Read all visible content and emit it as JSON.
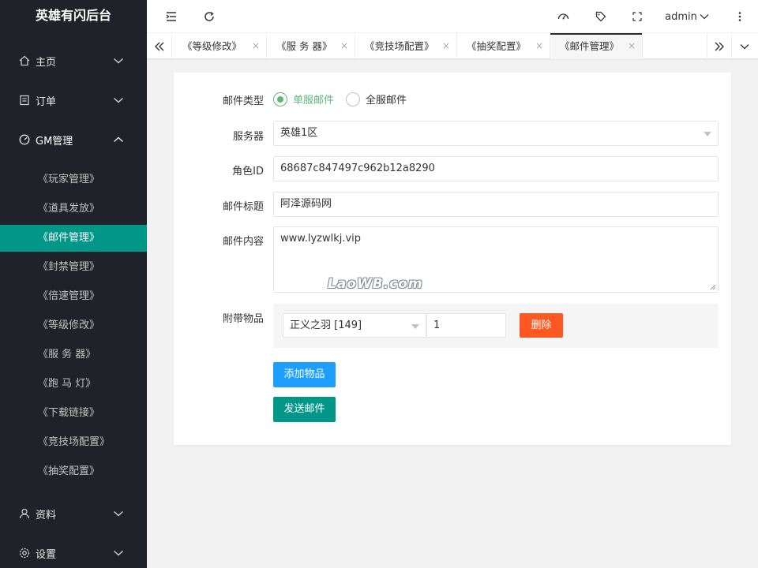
{
  "app": {
    "title": "英雄有闪后台"
  },
  "sidebar": {
    "groups": [
      {
        "label": "主页",
        "icon": "home-icon",
        "expanded": false
      },
      {
        "label": "订单",
        "icon": "list-icon",
        "expanded": false
      },
      {
        "label": "GM管理",
        "icon": "dashboard-icon",
        "expanded": true
      },
      {
        "label": "资料",
        "icon": "user-icon",
        "expanded": false
      },
      {
        "label": "设置",
        "icon": "settings-icon",
        "expanded": false
      }
    ],
    "gm_items": [
      {
        "label": "《玩家管理》"
      },
      {
        "label": "《道具发放》"
      },
      {
        "label": "《邮件管理》",
        "active": true
      },
      {
        "label": "《封禁管理》"
      },
      {
        "label": "《倍速管理》"
      },
      {
        "label": "《等级修改》"
      },
      {
        "label": "《服 务 器》"
      },
      {
        "label": "《跑 马 灯》"
      },
      {
        "label": "《下载链接》"
      },
      {
        "label": "《竞技场配置》"
      },
      {
        "label": "《抽奖配置》"
      }
    ]
  },
  "header": {
    "user": "admin",
    "icons": [
      "menu-fold-icon",
      "refresh-icon",
      "theme-icon",
      "note-icon",
      "fullscreen-icon",
      "more-icon"
    ]
  },
  "tabs": {
    "items": [
      {
        "label": "《等级修改》"
      },
      {
        "label": "《服 务 器》"
      },
      {
        "label": "《竞技场配置》"
      },
      {
        "label": "《抽奖配置》"
      },
      {
        "label": "《邮件管理》",
        "active": true
      }
    ],
    "close_glyph": "×"
  },
  "form": {
    "mail_type": {
      "label": "邮件类型",
      "options": [
        {
          "label": "单服邮件",
          "checked": true
        },
        {
          "label": "全服邮件",
          "checked": false
        }
      ]
    },
    "server": {
      "label": "服务器",
      "value": "英雄1区"
    },
    "role_id": {
      "label": "角色ID",
      "value": "68687c847497c962b12a8290"
    },
    "mail_title": {
      "label": "邮件标题",
      "value": "阿泽源码网"
    },
    "mail_content": {
      "label": "邮件内容",
      "value": "www.lyzwlkj.vip"
    },
    "attachments": {
      "label": "附带物品",
      "items": [
        {
          "item": "正义之羽 [149]",
          "quantity": "1",
          "delete_label": "删除"
        }
      ]
    },
    "add_item_label": "添加物品",
    "send_label": "发送邮件"
  },
  "watermark": "LaoWB.com",
  "colors": {
    "sidebar_bg": "#20222a",
    "accent": "#009688",
    "radio_green": "#5fb878",
    "add_btn": "#1e9fff",
    "delete_btn": "#ff5722"
  }
}
